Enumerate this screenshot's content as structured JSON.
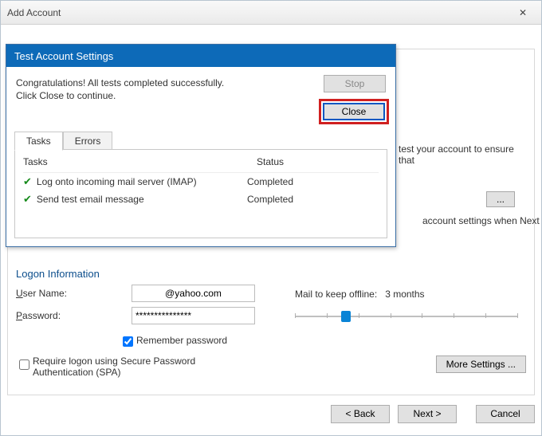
{
  "outer": {
    "title": "Add Account"
  },
  "inner": {
    "account_settings_hint": "test your account to ensure that",
    "auto_check_text": "account settings when Next",
    "more_settings_label": "More Settings ..."
  },
  "logon": {
    "section": "Logon Information",
    "user_label": "User Name:",
    "user_value": "@yahoo.com",
    "pass_label": "Password:",
    "pass_value": "***************",
    "remember_label": "Remember password",
    "require_spa_label": "Require logon using Secure Password Authentication (SPA)"
  },
  "mail": {
    "label": "Mail to keep offline:",
    "value": "3 months"
  },
  "footer": {
    "back": "< Back",
    "next": "Next >",
    "cancel": "Cancel"
  },
  "test": {
    "title": "Test Account Settings",
    "message": "Congratulations! All tests completed successfully. Click Close to continue.",
    "stop": "Stop",
    "close": "Close",
    "tab_tasks": "Tasks",
    "tab_errors": "Errors",
    "col_tasks": "Tasks",
    "col_status": "Status",
    "rows": [
      {
        "task": "Log onto incoming mail server (IMAP)",
        "status": "Completed"
      },
      {
        "task": "Send test email message",
        "status": "Completed"
      }
    ]
  }
}
